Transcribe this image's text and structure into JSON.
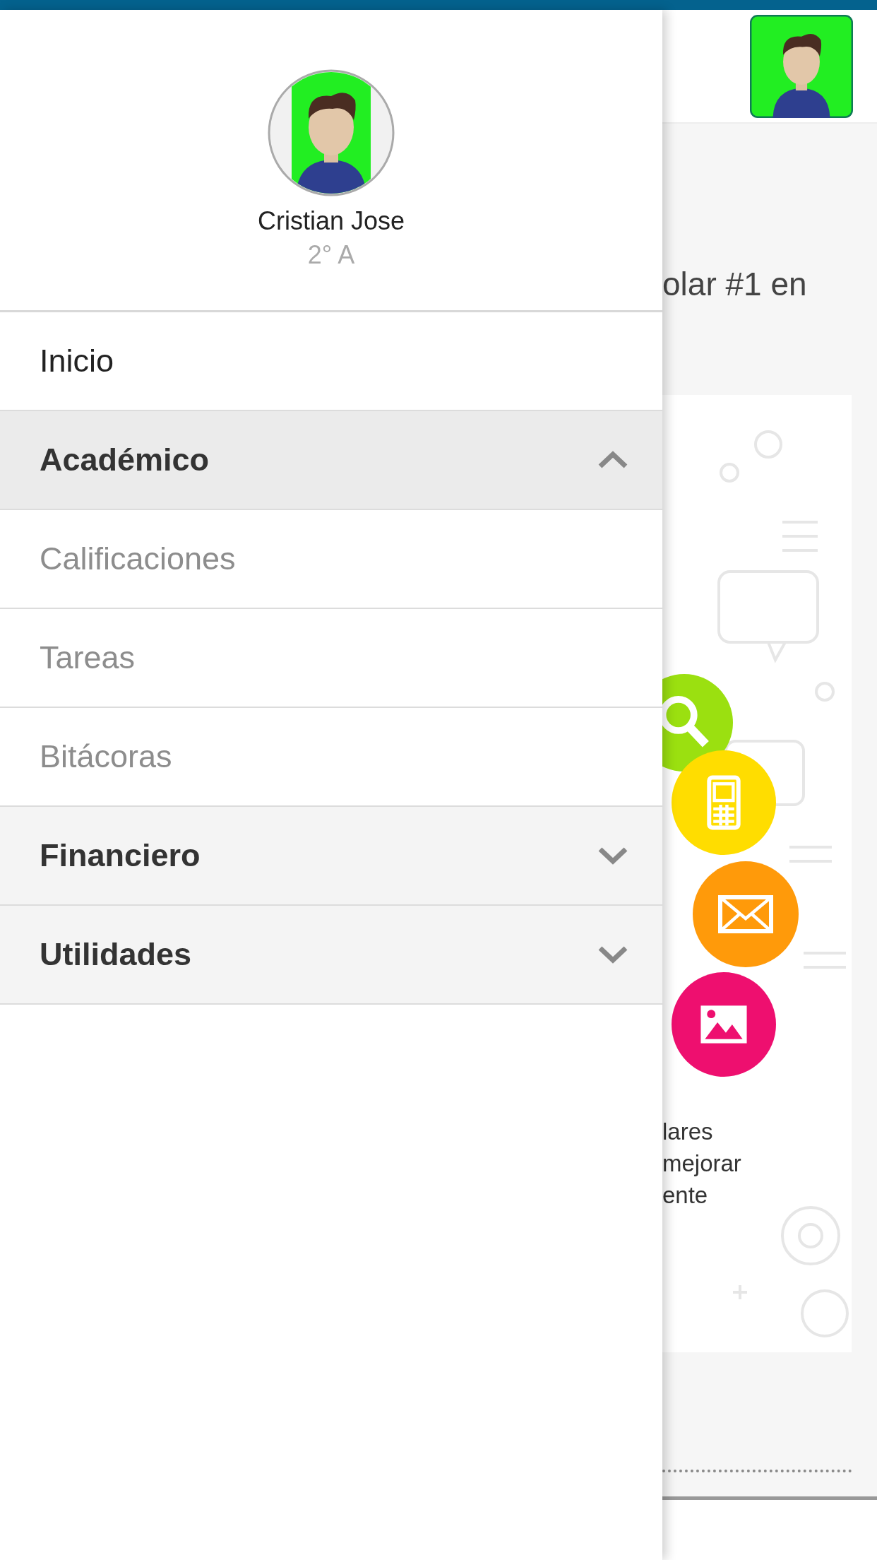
{
  "drawer": {
    "user": {
      "name": "Cristian Jose",
      "group": "2° A"
    },
    "menu": [
      {
        "label": "Inicio",
        "kind": "link"
      },
      {
        "label": "Académico",
        "kind": "section",
        "expanded": true,
        "children": [
          {
            "label": "Calificaciones"
          },
          {
            "label": "Tareas"
          },
          {
            "label": "Bitácoras"
          }
        ]
      },
      {
        "label": "Financiero",
        "kind": "section",
        "expanded": false
      },
      {
        "label": "Utilidades",
        "kind": "section",
        "expanded": false
      }
    ]
  },
  "page": {
    "heading": "olar #1 en",
    "text_lines": [
      "lares",
      "mejorar",
      "ente"
    ]
  }
}
